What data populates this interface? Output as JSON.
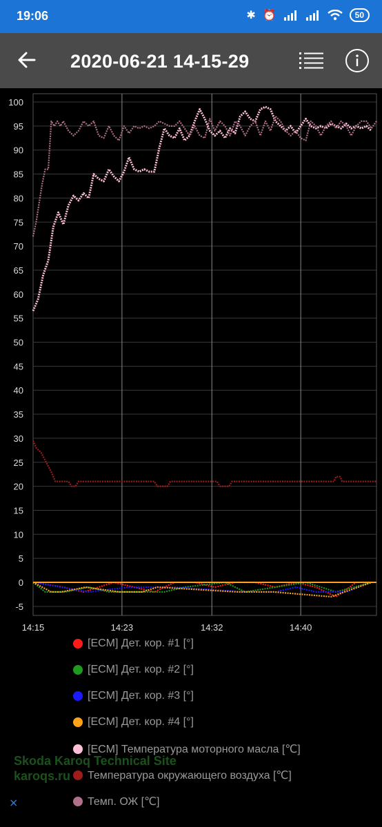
{
  "status_bar": {
    "time": "19:06",
    "battery": "50",
    "icons": [
      "bluetooth-icon",
      "alarm-icon",
      "signal-icon",
      "signal-icon",
      "wifi-icon",
      "battery-icon"
    ]
  },
  "app_bar": {
    "title": "2020-06-21 14-15-29",
    "back_icon": "arrow-left-icon",
    "list_icon": "list-icon",
    "info_icon": "info-icon"
  },
  "chart_data": {
    "type": "line",
    "title": "",
    "xlabel": "",
    "ylabel": "",
    "ylim": [
      -7,
      102
    ],
    "yticks": [
      100,
      95,
      90,
      85,
      80,
      75,
      70,
      65,
      60,
      55,
      50,
      45,
      40,
      35,
      30,
      25,
      20,
      15,
      10,
      5,
      0,
      -5
    ],
    "x_tick_labels": [
      "14:15",
      "14:23",
      "14:32",
      "14:40"
    ],
    "x_range_minutes": [
      0,
      34
    ],
    "x_tick_minutes": [
      0,
      8.8,
      17.7,
      26.5
    ],
    "grid": true,
    "series": [
      {
        "name": "[ECM] Дет. кор. #1 [°]",
        "color": "#ff1a1a",
        "x": [
          0,
          3,
          5,
          8,
          10,
          12,
          14,
          16,
          18,
          20,
          22,
          24,
          26,
          28,
          30,
          32,
          33.5
        ],
        "y": [
          0,
          -1,
          -2,
          0,
          -1,
          -2,
          0,
          0,
          -1,
          0,
          0,
          -1,
          0,
          -1,
          -3,
          0,
          0
        ]
      },
      {
        "name": "[ECM] Дет. кор. #2 [°]",
        "color": "#1f9a1f",
        "x": [
          0,
          1.2,
          3.2,
          5.5,
          7.5,
          10,
          13,
          15,
          19,
          21,
          24,
          27,
          30,
          33.5
        ],
        "y": [
          0,
          -2,
          -2,
          -1,
          -2,
          -2,
          -2,
          -1,
          0,
          -2,
          -1,
          0,
          -2,
          0
        ]
      },
      {
        "name": "[ECM] Дет. кор. #3 [°]",
        "color": "#1a1aff",
        "x": [
          0,
          5.5,
          9.5,
          14,
          21,
          22.5,
          24,
          26,
          28,
          31,
          33.5
        ],
        "y": [
          0,
          -2,
          -1,
          -1,
          -2,
          -2,
          -2,
          -1,
          -2,
          -2,
          0
        ]
      },
      {
        "name": "[ECM] Дет. кор. #4 [°]",
        "color": "#ffa21a",
        "x": [
          0,
          1.8,
          2.8,
          5.2,
          8.5,
          10.2,
          10.8,
          12.3,
          20.2,
          22.4,
          23.8,
          29.5,
          33.5
        ],
        "y": [
          0,
          -2,
          -2,
          -1,
          -2,
          -2,
          -2,
          -1,
          -2,
          -2,
          -2,
          -3,
          0
        ]
      },
      {
        "name": "[ECM] Температура моторного масла [℃]",
        "color": "#ffbfd9",
        "x": [
          0,
          0.5,
          1,
          1.5,
          2,
          2.5,
          3,
          3.5,
          4,
          4.5,
          5,
          5.5,
          6,
          6.5,
          7,
          7.5,
          8,
          8.5,
          9,
          9.5,
          10,
          10.5,
          11,
          11.5,
          12,
          12.5,
          13,
          13.5,
          14,
          14.5,
          15,
          15.5,
          16,
          16.5,
          17,
          17.5,
          18,
          18.5,
          19,
          19.5,
          20,
          20.5,
          21,
          21.5,
          22,
          22.5,
          23,
          23.5,
          24,
          24.5,
          25,
          25.5,
          26,
          26.5,
          27,
          27.5,
          28,
          28.5,
          29,
          29.5,
          30,
          30.5,
          31,
          31.5,
          32,
          32.5,
          33,
          33.5
        ],
        "y": [
          56.5,
          59,
          64,
          67,
          74,
          77,
          74.5,
          78.5,
          80.5,
          79.5,
          81,
          80,
          85,
          84,
          83.5,
          86,
          84.5,
          83.5,
          85.5,
          88.5,
          86,
          85.5,
          86,
          85.5,
          85.5,
          90.5,
          94.5,
          93,
          92.5,
          94.5,
          92,
          93,
          96,
          98.5,
          96.5,
          94,
          93,
          94,
          92.5,
          94.5,
          93.5,
          97,
          98,
          96.5,
          96,
          98.5,
          99,
          98.5,
          96,
          95,
          94,
          95,
          93.5,
          95,
          96.5,
          95,
          94.5,
          95,
          94.5,
          95.5,
          95,
          94.5,
          95.5,
          94.5,
          95,
          94.5,
          95,
          94
        ]
      },
      {
        "name": "Температура окружающего воздуха [℃]",
        "color": "#a01c1c",
        "x": [
          0,
          0.3,
          0.8,
          1.3,
          1.8,
          2.2,
          3.5,
          3.8,
          4.2,
          4.5,
          12,
          12.3,
          13.3,
          13.6,
          18.2,
          18.5,
          19.4,
          19.7,
          29.8,
          30,
          30.4,
          30.6,
          34
        ],
        "y": [
          29.5,
          28,
          27,
          25,
          23,
          21,
          21,
          20,
          20,
          21,
          21,
          20,
          20,
          21,
          21,
          20,
          20,
          21,
          21,
          22,
          22,
          21,
          21
        ]
      },
      {
        "name": "Темп. ОЖ [℃]",
        "color": "#b0708a",
        "x": [
          0,
          0.3,
          0.6,
          0.9,
          1.2,
          1.5,
          1.8,
          2.1,
          2.4,
          2.7,
          3,
          3.5,
          4,
          4.5,
          5,
          5.5,
          6,
          6.5,
          7,
          7.5,
          8,
          8.5,
          9,
          9.5,
          10,
          10.5,
          11,
          11.5,
          12,
          12.5,
          13,
          13.5,
          14,
          14.5,
          15,
          15.5,
          16,
          16.5,
          17,
          17.5,
          18,
          18.5,
          19,
          19.5,
          20,
          20.5,
          21,
          21.5,
          22,
          22.5,
          23,
          23.5,
          24,
          24.5,
          25,
          25.5,
          26,
          26.5,
          27,
          27.5,
          28,
          28.5,
          29,
          29.5,
          30,
          30.5,
          31,
          31.5,
          32,
          32.5,
          33,
          33.5,
          34
        ],
        "y": [
          72,
          75,
          79,
          83,
          86,
          86,
          96,
          95,
          96,
          95,
          96,
          94,
          93,
          94,
          96,
          95,
          96,
          93,
          92.5,
          95,
          93,
          92,
          95,
          93.5,
          95,
          94.5,
          95,
          94.5,
          95,
          96,
          95.5,
          95,
          95,
          96,
          94.5,
          93,
          95,
          93,
          92.5,
          96.5,
          94,
          96,
          95,
          93,
          96,
          95,
          93,
          95,
          96,
          93,
          96,
          94,
          97,
          96,
          94,
          93,
          94,
          92.5,
          92,
          96,
          95,
          93,
          95,
          96,
          94.5,
          96,
          95,
          93,
          95,
          96,
          96,
          94.5,
          96
        ]
      }
    ]
  },
  "watermark": {
    "line1": "Skoda Karoq Technical Site",
    "line2": "karoqs.ru"
  },
  "side_icon": "download-icon"
}
